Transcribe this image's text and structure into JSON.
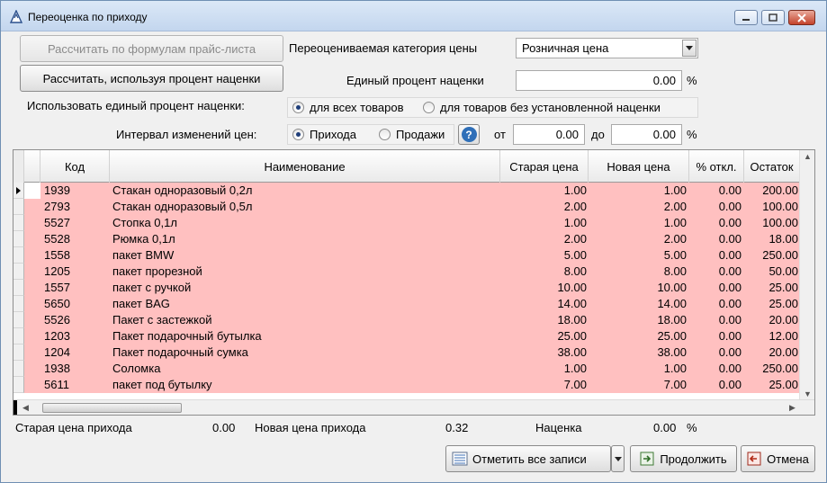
{
  "window": {
    "title": "Переоценка по приходу"
  },
  "buttons": {
    "calc_by_formulas": "Рассчитать по формулам прайс-листа",
    "calc_by_percent": "Рассчитать, используя процент наценки",
    "mark_all": "Отметить все записи",
    "continue": "Продолжить",
    "cancel": "Отмена"
  },
  "form": {
    "price_category_label": "Переоцениваемая категория цены",
    "price_category_value": "Розничная цена",
    "unified_percent_label": "Единый процент наценки",
    "unified_percent_value": "0.00",
    "percent_unit": "%",
    "use_unified_label": "Использовать единый процент наценки:",
    "use_unified_options": [
      "для всех товаров",
      "для товаров без установленной наценки"
    ],
    "use_unified_selected": 0,
    "interval_label": "Интервал изменений цен:",
    "interval_options": [
      "Прихода",
      "Продажи"
    ],
    "interval_selected": 0,
    "from_label": "от",
    "from_value": "0.00",
    "to_label": "до",
    "to_value": "0.00"
  },
  "table": {
    "columns": [
      "Код",
      "Наименование",
      "Старая цена",
      "Новая цена",
      "% откл.",
      "Остаток"
    ],
    "rows": [
      [
        "1939",
        "Стакан одноразовый 0,2л",
        "1.00",
        "1.00",
        "0.00",
        "200.00"
      ],
      [
        "2793",
        "Стакан одноразовый 0,5л",
        "2.00",
        "2.00",
        "0.00",
        "100.00"
      ],
      [
        "5527",
        "Стопка 0,1л",
        "1.00",
        "1.00",
        "0.00",
        "100.00"
      ],
      [
        "5528",
        "Рюмка 0,1л",
        "2.00",
        "2.00",
        "0.00",
        "18.00"
      ],
      [
        "1558",
        "пакет BMW",
        "5.00",
        "5.00",
        "0.00",
        "250.00"
      ],
      [
        "1205",
        "пакет прорезной",
        "8.00",
        "8.00",
        "0.00",
        "50.00"
      ],
      [
        "1557",
        "пакет с ручкой",
        "10.00",
        "10.00",
        "0.00",
        "25.00"
      ],
      [
        "5650",
        "пакет BAG",
        "14.00",
        "14.00",
        "0.00",
        "25.00"
      ],
      [
        "5526",
        "Пакет с застежкой",
        "18.00",
        "18.00",
        "0.00",
        "20.00"
      ],
      [
        "1203",
        "Пакет подарочный бутылка",
        "25.00",
        "25.00",
        "0.00",
        "12.00"
      ],
      [
        "1204",
        "Пакет подарочный сумка",
        "38.00",
        "38.00",
        "0.00",
        "20.00"
      ],
      [
        "1938",
        "Соломка",
        "1.00",
        "1.00",
        "0.00",
        "250.00"
      ],
      [
        "5611",
        "пакет под бутылку",
        "7.00",
        "7.00",
        "0.00",
        "25.00"
      ]
    ]
  },
  "summary": {
    "old_price_label": "Старая цена прихода",
    "old_price_value": "0.00",
    "new_price_label": "Новая цена прихода",
    "new_price_value": "0.32",
    "markup_label": "Наценка",
    "markup_value": "0.00",
    "markup_unit": "%"
  },
  "colors": {
    "row_highlight": "#ffc0c0",
    "close_button": "#c4432b"
  }
}
